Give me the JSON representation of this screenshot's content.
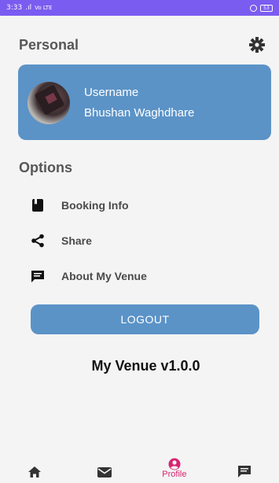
{
  "status_bar": {
    "time": "3:33",
    "signal": ".ıl",
    "network": "Vo LTE",
    "battery": "53"
  },
  "personal": {
    "title": "Personal",
    "settings_icon": "settings-icon"
  },
  "profile_card": {
    "line1": "Username",
    "line2": "Bhushan Waghdhare"
  },
  "options": {
    "title": "Options",
    "items": [
      {
        "label": "Booking Info",
        "icon": "book-icon"
      },
      {
        "label": "Share",
        "icon": "share-icon"
      },
      {
        "label": "About My Venue",
        "icon": "chat-icon"
      }
    ]
  },
  "logout_label": "LOGOUT",
  "version": "My Venue v1.0.0",
  "bottom_nav": {
    "items": [
      {
        "icon": "home-icon",
        "label": ""
      },
      {
        "icon": "mail-icon",
        "label": ""
      },
      {
        "icon": "profile-icon",
        "label": "Profile",
        "active": true
      },
      {
        "icon": "chat-icon",
        "label": ""
      }
    ]
  },
  "colors": {
    "accent": "#5b93c7",
    "status_bar": "#7b5cf0",
    "active_nav": "#d6246f",
    "background": "#f4f4f4"
  }
}
